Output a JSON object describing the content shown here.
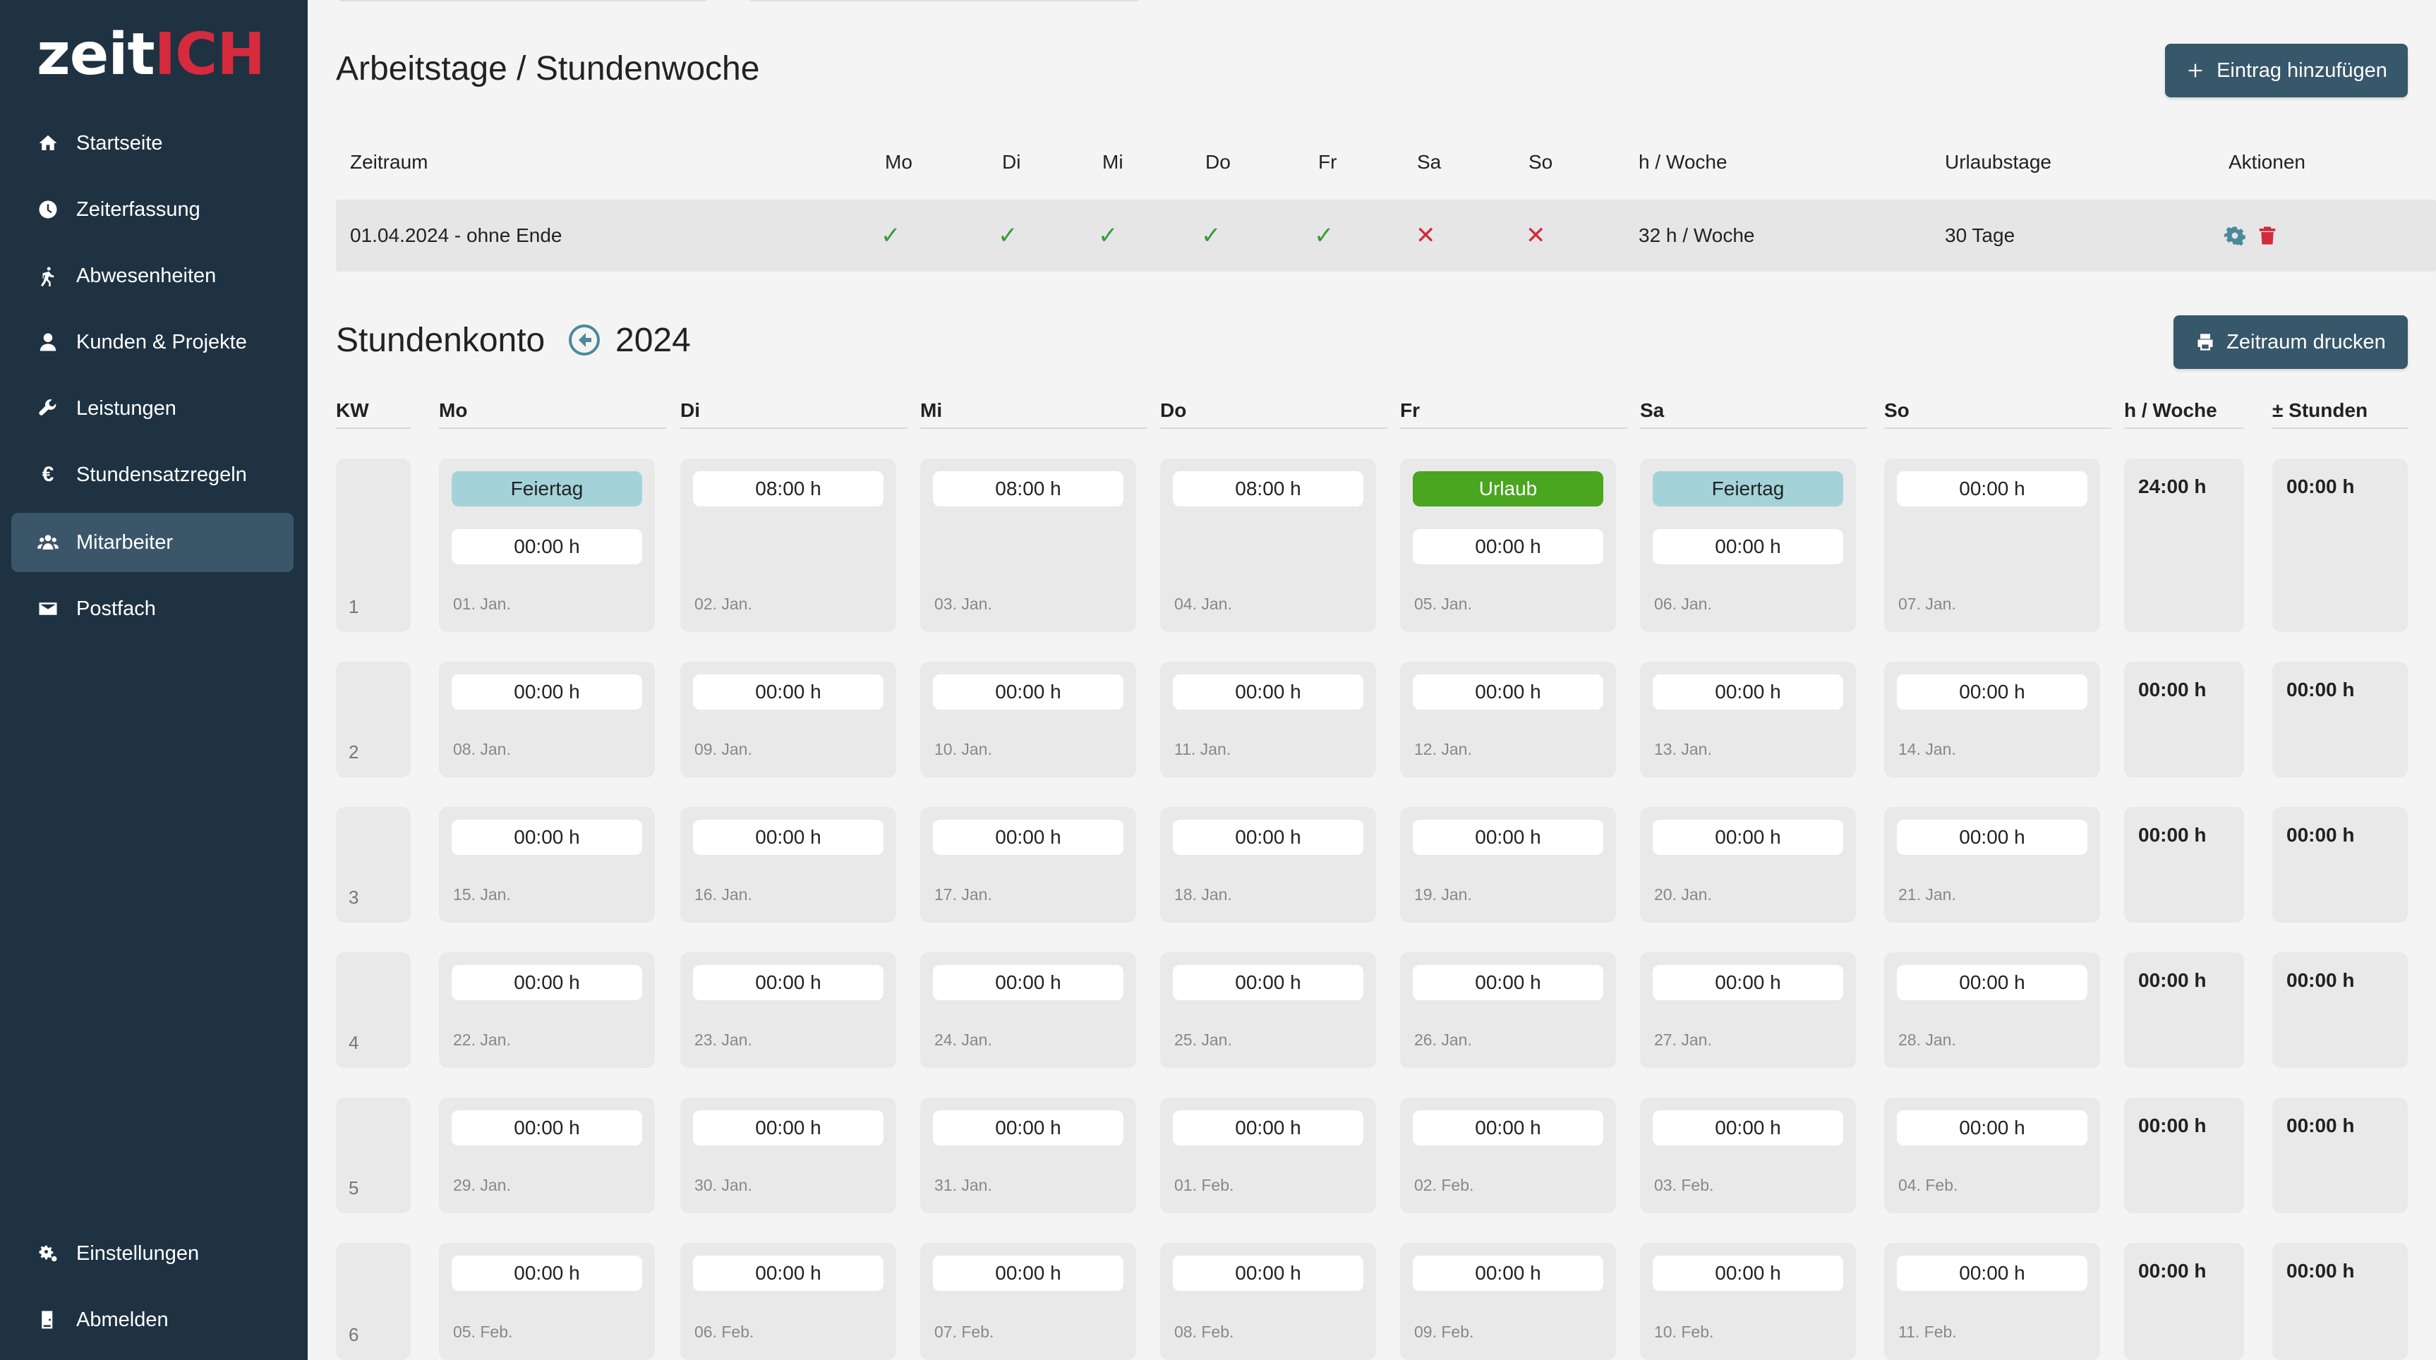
{
  "brand": {
    "part1": "zeit",
    "part2": "ICH"
  },
  "sidebar": {
    "items": [
      {
        "label": "Startseite",
        "icon": "home-icon"
      },
      {
        "label": "Zeiterfassung",
        "icon": "clock-icon"
      },
      {
        "label": "Abwesenheiten",
        "icon": "walking-icon"
      },
      {
        "label": "Kunden & Projekte",
        "icon": "user-icon"
      },
      {
        "label": "Leistungen",
        "icon": "wrench-icon"
      },
      {
        "label": "Stundensatzregeln",
        "icon": "euro-icon"
      },
      {
        "label": "Mitarbeiter",
        "icon": "users-icon"
      },
      {
        "label": "Postfach",
        "icon": "envelope-icon"
      }
    ],
    "bottom": [
      {
        "label": "Einstellungen",
        "icon": "gears-icon"
      },
      {
        "label": "Abmelden",
        "icon": "logout-icon"
      }
    ]
  },
  "arbeitstage": {
    "title": "Arbeitstage / Stundenwoche",
    "add_button": "Eintrag hinzufügen",
    "headers": [
      "Zeitraum",
      "Mo",
      "Di",
      "Mi",
      "Do",
      "Fr",
      "Sa",
      "So",
      "h / Woche",
      "Urlaubstage",
      "Aktionen"
    ],
    "row": {
      "zeitraum": "01.04.2024 - ohne Ende",
      "days": [
        "check",
        "check",
        "check",
        "check",
        "check",
        "cross",
        "cross"
      ],
      "h_woche": "32 h / Woche",
      "urlaubstage": "30 Tage"
    }
  },
  "stundenkonto": {
    "title": "Stundenkonto",
    "year": "2024",
    "print_button": "Zeitraum drucken",
    "headers": [
      "KW",
      "Mo",
      "Di",
      "Mi",
      "Do",
      "Fr",
      "Sa",
      "So",
      "h / Woche",
      "Stunden"
    ],
    "weeks": [
      {
        "kw": "1",
        "days": [
          {
            "date": "01. Jan.",
            "badge": "Feiertag",
            "value": "00:00 h"
          },
          {
            "date": "02. Jan.",
            "value": "08:00 h"
          },
          {
            "date": "03. Jan.",
            "value": "08:00 h"
          },
          {
            "date": "04. Jan.",
            "value": "08:00 h"
          },
          {
            "date": "05. Jan.",
            "badge": "Urlaub",
            "value": "00:00 h"
          },
          {
            "date": "06. Jan.",
            "badge": "Feiertag",
            "value": "00:00 h"
          },
          {
            "date": "07. Jan.",
            "value": "00:00 h"
          }
        ],
        "h_woche": "24:00 h",
        "stunden": "00:00 h"
      },
      {
        "kw": "2",
        "days": [
          {
            "date": "08. Jan.",
            "value": "00:00 h"
          },
          {
            "date": "09. Jan.",
            "value": "00:00 h"
          },
          {
            "date": "10. Jan.",
            "value": "00:00 h"
          },
          {
            "date": "11. Jan.",
            "value": "00:00 h"
          },
          {
            "date": "12. Jan.",
            "value": "00:00 h"
          },
          {
            "date": "13. Jan.",
            "value": "00:00 h"
          },
          {
            "date": "14. Jan.",
            "value": "00:00 h"
          }
        ],
        "h_woche": "00:00 h",
        "stunden": "00:00 h"
      },
      {
        "kw": "3",
        "days": [
          {
            "date": "15. Jan.",
            "value": "00:00 h"
          },
          {
            "date": "16. Jan.",
            "value": "00:00 h"
          },
          {
            "date": "17. Jan.",
            "value": "00:00 h"
          },
          {
            "date": "18. Jan.",
            "value": "00:00 h"
          },
          {
            "date": "19. Jan.",
            "value": "00:00 h"
          },
          {
            "date": "20. Jan.",
            "value": "00:00 h"
          },
          {
            "date": "21. Jan.",
            "value": "00:00 h"
          }
        ],
        "h_woche": "00:00 h",
        "stunden": "00:00 h"
      },
      {
        "kw": "4",
        "days": [
          {
            "date": "22. Jan.",
            "value": "00:00 h"
          },
          {
            "date": "23. Jan.",
            "value": "00:00 h"
          },
          {
            "date": "24. Jan.",
            "value": "00:00 h"
          },
          {
            "date": "25. Jan.",
            "value": "00:00 h"
          },
          {
            "date": "26. Jan.",
            "value": "00:00 h"
          },
          {
            "date": "27. Jan.",
            "value": "00:00 h"
          },
          {
            "date": "28. Jan.",
            "value": "00:00 h"
          }
        ],
        "h_woche": "00:00 h",
        "stunden": "00:00 h"
      },
      {
        "kw": "5",
        "days": [
          {
            "date": "29. Jan.",
            "value": "00:00 h"
          },
          {
            "date": "30. Jan.",
            "value": "00:00 h"
          },
          {
            "date": "31. Jan.",
            "value": "00:00 h"
          },
          {
            "date": "01. Feb.",
            "value": "00:00 h"
          },
          {
            "date": "02. Feb.",
            "value": "00:00 h"
          },
          {
            "date": "03. Feb.",
            "value": "00:00 h"
          },
          {
            "date": "04. Feb.",
            "value": "00:00 h"
          }
        ],
        "h_woche": "00:00 h",
        "stunden": "00:00 h"
      },
      {
        "kw": "6",
        "days": [
          {
            "date": "05. Feb.",
            "value": "00:00 h"
          },
          {
            "date": "06. Feb.",
            "value": "00:00 h"
          },
          {
            "date": "07. Feb.",
            "value": "00:00 h"
          },
          {
            "date": "08. Feb.",
            "value": "00:00 h"
          },
          {
            "date": "09. Feb.",
            "value": "00:00 h"
          },
          {
            "date": "10. Feb.",
            "value": "00:00 h"
          },
          {
            "date": "11. Feb.",
            "value": "00:00 h"
          }
        ],
        "h_woche": "00:00 h",
        "stunden": "00:00 h"
      }
    ]
  },
  "colors": {
    "sidebar": "#1e3242",
    "accent": "#37576a",
    "feiertag": "#a3d3d9",
    "urlaub": "#4aa51f",
    "check": "#3a9a3a",
    "cross": "#d22b3b"
  }
}
